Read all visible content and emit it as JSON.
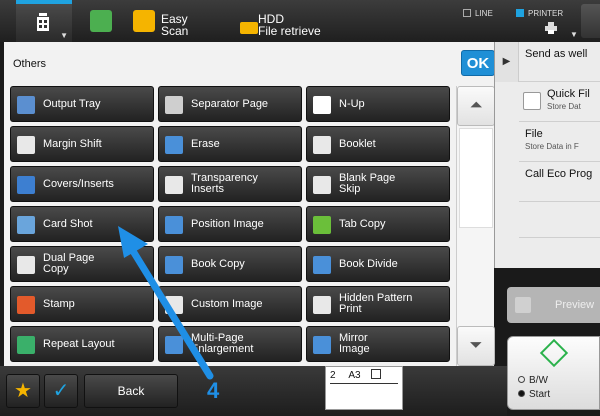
{
  "topbar": {
    "easy_scan": [
      "Easy",
      "Scan"
    ],
    "hdd": [
      "HDD",
      "File retrieve"
    ],
    "line_label": "LINE",
    "printer_label": "PRINTER"
  },
  "panel": {
    "title": "Others",
    "ok_label": "OK"
  },
  "buttons": [
    {
      "label": [
        "Output Tray"
      ],
      "icon": "output-tray-icon",
      "color": "#5b8fd0"
    },
    {
      "label": [
        "Separator Page"
      ],
      "icon": "separator-page-icon",
      "color": "#cfcfcf"
    },
    {
      "label": [
        "N-Up"
      ],
      "icon": "n-up-icon",
      "color": "#ffffff"
    },
    {
      "label": [
        "Margin Shift"
      ],
      "icon": "margin-shift-icon",
      "color": "#e8e8e8"
    },
    {
      "label": [
        "Erase"
      ],
      "icon": "erase-icon",
      "color": "#4a90d9"
    },
    {
      "label": [
        "Booklet"
      ],
      "icon": "booklet-icon",
      "color": "#e8e8e8"
    },
    {
      "label": [
        "Covers/Inserts"
      ],
      "icon": "covers-inserts-icon",
      "color": "#3d7fd1"
    },
    {
      "label": [
        "Transparency",
        "Inserts"
      ],
      "icon": "transparency-inserts-icon",
      "color": "#e8e8e8"
    },
    {
      "label": [
        "Blank Page",
        "Skip"
      ],
      "icon": "blank-page-skip-icon",
      "color": "#e8e8e8"
    },
    {
      "label": [
        "Card Shot"
      ],
      "icon": "card-shot-icon",
      "color": "#6aa5dc"
    },
    {
      "label": [
        "Position Image"
      ],
      "icon": "position-image-icon",
      "color": "#4a90d9"
    },
    {
      "label": [
        "Tab Copy"
      ],
      "icon": "tab-copy-icon",
      "color": "#6bbf3a"
    },
    {
      "label": [
        "Dual Page",
        "Copy"
      ],
      "icon": "dual-page-copy-icon",
      "color": "#e8e8e8"
    },
    {
      "label": [
        "Book Copy"
      ],
      "icon": "book-copy-icon",
      "color": "#4a90d9"
    },
    {
      "label": [
        "Book Divide"
      ],
      "icon": "book-divide-icon",
      "color": "#4a90d9"
    },
    {
      "label": [
        "Stamp"
      ],
      "icon": "stamp-icon",
      "color": "#e35a2b"
    },
    {
      "label": [
        "Custom Image"
      ],
      "icon": "custom-image-icon",
      "color": "#e8e8e8"
    },
    {
      "label": [
        "Hidden Pattern",
        "Print"
      ],
      "icon": "hidden-pattern-print-icon",
      "color": "#e8e8e8"
    },
    {
      "label": [
        "Repeat Layout"
      ],
      "icon": "repeat-layout-icon",
      "color": "#3ab06a"
    },
    {
      "label": [
        "Multi-Page",
        "Enlargement"
      ],
      "icon": "multi-page-enlargement-icon",
      "color": "#4a90d9"
    },
    {
      "label": [
        "Mirror",
        "Image"
      ],
      "icon": "mirror-image-icon",
      "color": "#4a90d9"
    }
  ],
  "side": {
    "items": [
      {
        "title": "Send as well",
        "sub": ""
      },
      {
        "title": "Quick Fil",
        "sub": "Store Dat"
      },
      {
        "title": "File",
        "sub": "Store Data in F"
      },
      {
        "title": "Call Eco Prog",
        "sub": ""
      }
    ],
    "preview_label": "Preview",
    "bw_label": "B/W",
    "start_label": "Start"
  },
  "bottom": {
    "back_label": "Back",
    "paper_count": "2",
    "paper_size": "A3"
  },
  "annotation": {
    "number": "4"
  },
  "colors": {
    "accent": "#1fa3e0",
    "ok": "#1f8fd6",
    "annotation": "#1f8fe6"
  }
}
